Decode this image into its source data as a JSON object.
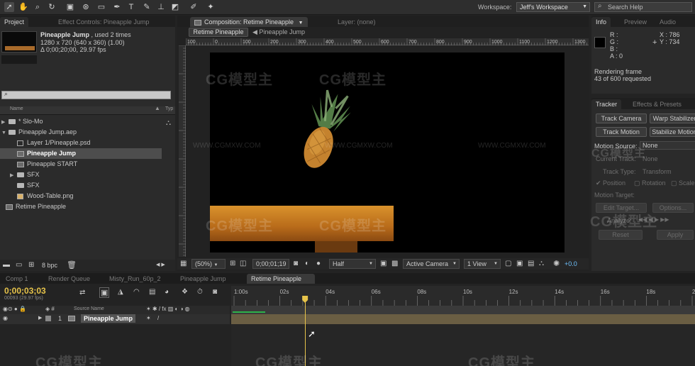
{
  "colors": {
    "accent_yellow": "#e6c34a",
    "track_gold": "#6a5e43",
    "work_area_green": "#2db34a",
    "plus_zero_cyan": "#6fc3ff"
  },
  "toolbar": {
    "tools": [
      "selection-tool-icon",
      "hand-tool-icon",
      "zoom-tool-icon",
      "rotation-tool-icon",
      "camera-tool-icon",
      "pan-behind-tool-icon",
      "mask-tool-icon",
      "pen-tool-icon",
      "type-tool-icon",
      "brush-tool-icon",
      "eraser-tool-icon",
      "puppet-tool-icon"
    ],
    "workspace_label": "Workspace:",
    "workspace_value": "Jeff's Workspace",
    "search_placeholder": "Search Help"
  },
  "project": {
    "tab_project": "Project",
    "tab_effects": "Effect Controls: Pineapple Jump",
    "item_name": "Pineapple Jump",
    "item_used": ", used 2 times",
    "item_dims": "1280 x 720  (640 x 360) (1.00)",
    "item_duration": "Δ 0;00;20;00, 29.97 fps",
    "search_value": "",
    "col_name": "Name",
    "col_type": "Typ",
    "items": [
      {
        "label": "* Slo-Mo",
        "kind": "folder",
        "indent": 0,
        "open": false
      },
      {
        "label": "Pineapple Jump.aep",
        "kind": "folder",
        "indent": 0,
        "open": true
      },
      {
        "label": "Layer 1/Pineapple.psd",
        "kind": "file",
        "indent": 1
      },
      {
        "label": "Pineapple Jump",
        "kind": "comp",
        "indent": 1,
        "selected": true
      },
      {
        "label": "Pineapple START",
        "kind": "comp",
        "indent": 1
      },
      {
        "label": "SFX",
        "kind": "folder",
        "indent": 1,
        "open": false
      },
      {
        "label": "SFX",
        "kind": "folder",
        "indent": 1
      },
      {
        "label": "Wood-Table.png",
        "kind": "file",
        "indent": 1
      },
      {
        "label": "Retime Pineapple",
        "kind": "comp",
        "indent": 0
      }
    ],
    "bpc": "8 bpc"
  },
  "composition": {
    "tab_label": "Composition: Retime Pineapple",
    "layer_tab": "Layer: (none)",
    "breadcrumb_active": "Retime Pineapple",
    "breadcrumb_next": "Pineapple Jump",
    "ruler_ticks": [
      "100",
      "0",
      "100",
      "200",
      "300",
      "400",
      "500",
      "600",
      "700",
      "800",
      "900",
      "1000",
      "1100",
      "1200",
      "1300"
    ],
    "zoom": "(50%)",
    "timecode": "0;00;01;19",
    "resolution": "Half",
    "camera": "Active Camera",
    "views": "1 View",
    "exposure": "+0.0"
  },
  "watermark": {
    "brand": "CG模型主",
    "url": "WWW.CGMXW.COM"
  },
  "info": {
    "tab_info": "Info",
    "tab_preview": "Preview",
    "tab_audio": "Audio",
    "r": "R :",
    "g": "G :",
    "b": "B :",
    "a": "A : 0",
    "x": "X : 786",
    "y": "Y : 734",
    "render_line1": "Rendering frame",
    "render_line2": "43 of 600 requested"
  },
  "tracker": {
    "tab_tracker": "Tracker",
    "tab_effects": "Effects & Presets",
    "btn_track_camera": "Track Camera",
    "btn_warp": "Warp Stabilizer",
    "btn_track_motion": "Track Motion",
    "btn_stabilize": "Stabilize Motion",
    "motion_source_label": "Motion Source:",
    "motion_source_value": "None",
    "current_track_label": "Current Track:",
    "current_track_value": "None",
    "track_type_label": "Track Type:",
    "track_type_value": "Transform",
    "position": "Position",
    "rotation": "Rotation",
    "scale": "Scale",
    "motion_target": "Motion Target:",
    "edit_target": "Edit Target...",
    "options": "Options...",
    "analyze": "Analyze:",
    "reset": "Reset",
    "apply": "Apply"
  },
  "timeline": {
    "tabs": [
      "Comp 1",
      "Render Queue",
      "Misty_Run_60p_2",
      "Pineapple Jump",
      "Retime Pineapple"
    ],
    "active_tab": 4,
    "current_time": "0;00;03;03",
    "frame_info": "00093 (29.97 fps)",
    "col_source": "Source Name",
    "layer_index": "1",
    "layer_name": "Pineapple Jump",
    "time_labels": [
      "1:00s",
      "02s",
      "04s",
      "06s",
      "08s",
      "10s",
      "12s",
      "14s",
      "16s",
      "18s",
      "20s"
    ],
    "playhead_time": 3.1,
    "duration": 20
  }
}
